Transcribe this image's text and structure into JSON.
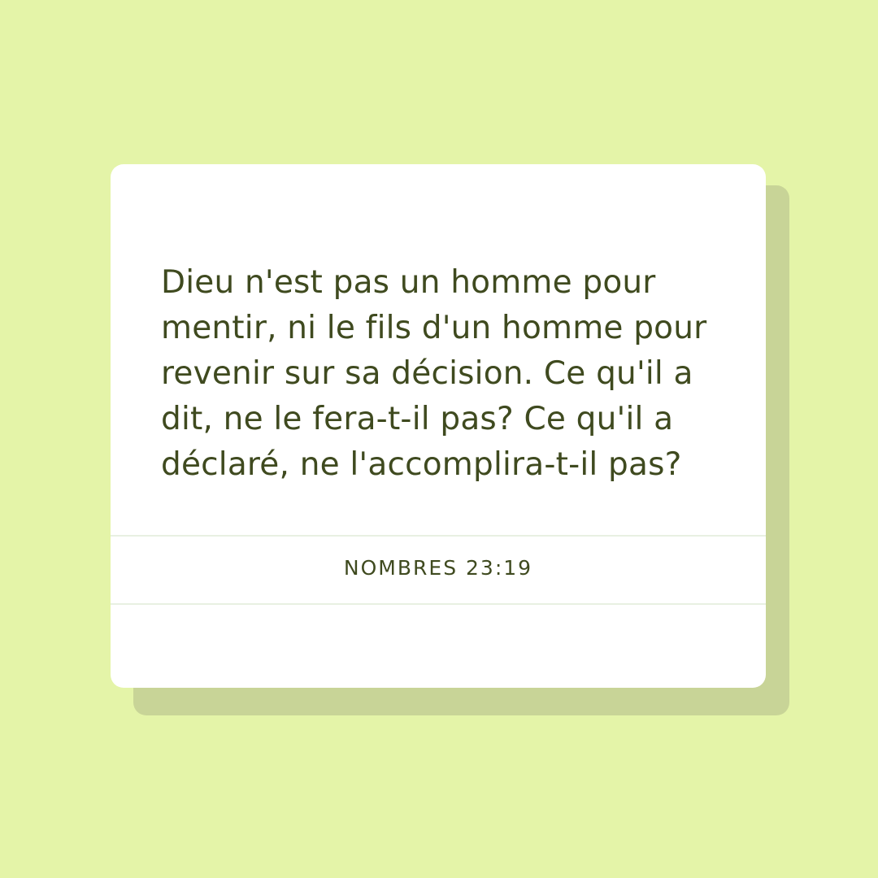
{
  "card": {
    "verse_text": "Dieu n'est pas un homme pour mentir, ni le fils d'un homme pour revenir sur sa décision. Ce qu'il a dit, ne le fera-t-il pas? Ce qu'il a déclaré, ne l'accomplira-t-il pas?",
    "reference": "NOMBRES 23:19"
  },
  "colors": {
    "background": "#e4f4a8",
    "card": "#ffffff",
    "shadow": "#c8d497",
    "text": "#3f4a1f"
  }
}
